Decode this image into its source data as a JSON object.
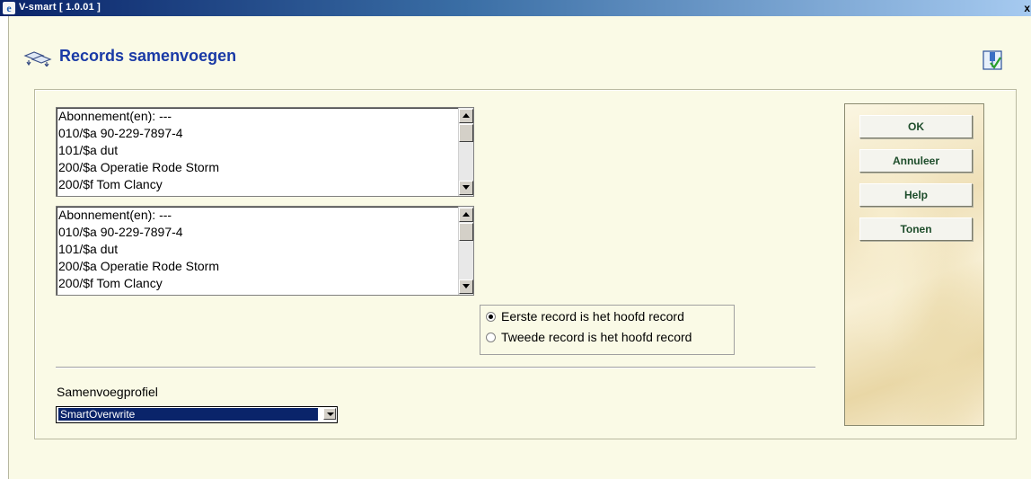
{
  "window": {
    "title": "V-smart [ 1.0.01 ]",
    "close_glyph": "x"
  },
  "header": {
    "title": "Records samenvoegen",
    "icon": "merge-records-icon",
    "pin_icon": "check-pin-icon"
  },
  "record1": {
    "lines": [
      "Abonnement(en): ---",
      "010/$a 90-229-7897-4",
      "101/$a dut",
      "200/$a Operatie Rode Storm",
      "200/$f Tom Clancy"
    ]
  },
  "record2": {
    "lines": [
      "Abonnement(en): ---",
      "010/$a 90-229-7897-4",
      "101/$a dut",
      "200/$a Operatie Rode Storm",
      "200/$f Tom Clancy"
    ]
  },
  "main_record": {
    "options": [
      {
        "label": "Eerste record is het hoofd record",
        "selected": true
      },
      {
        "label": "Tweede record is het hoofd record",
        "selected": false
      }
    ]
  },
  "profile": {
    "label": "Samenvoegprofiel",
    "selected": "SmartOverwrite"
  },
  "buttons": {
    "ok": "OK",
    "cancel": "Annuleer",
    "help": "Help",
    "show": "Tonen"
  },
  "colors": {
    "title_blue": "#1a3aa6",
    "background": "#fafae6",
    "button_text": "#1e4d2b"
  }
}
